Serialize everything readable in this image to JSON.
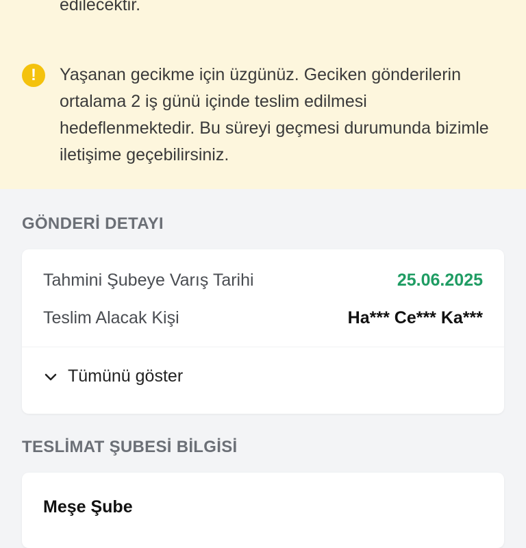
{
  "notice": {
    "previous_text_tail": "edilecektir.",
    "warning_text": "Yaşanan gecikme için üzgünüz. Geciken gönderilerin ortalama 2 iş günü içinde teslim edilmesi hedeflenmektedir. Bu süreyi geçmesi durumunda bizimle iletişime geçebilirsiniz.",
    "icon": "warning-icon"
  },
  "shipment_details": {
    "section_title": "GÖNDERİ DETAYI",
    "rows": [
      {
        "label": "Tahmini Şubeye Varış Tarihi",
        "value": "25.06.2025"
      },
      {
        "label": "Teslim Alacak Kişi",
        "value": "Ha*** Ce*** Ka***"
      }
    ],
    "show_all_label": "Tümünü göster"
  },
  "delivery_branch": {
    "section_title": "TESLİMAT ŞUBESİ BİLGİSİ",
    "branch_name": "Meşe Şube"
  },
  "colors": {
    "notice_background": "#fdf6dd",
    "warning_icon": "#f4c20d",
    "date_value": "#1f9c63",
    "page_background": "#f3f4f6"
  }
}
